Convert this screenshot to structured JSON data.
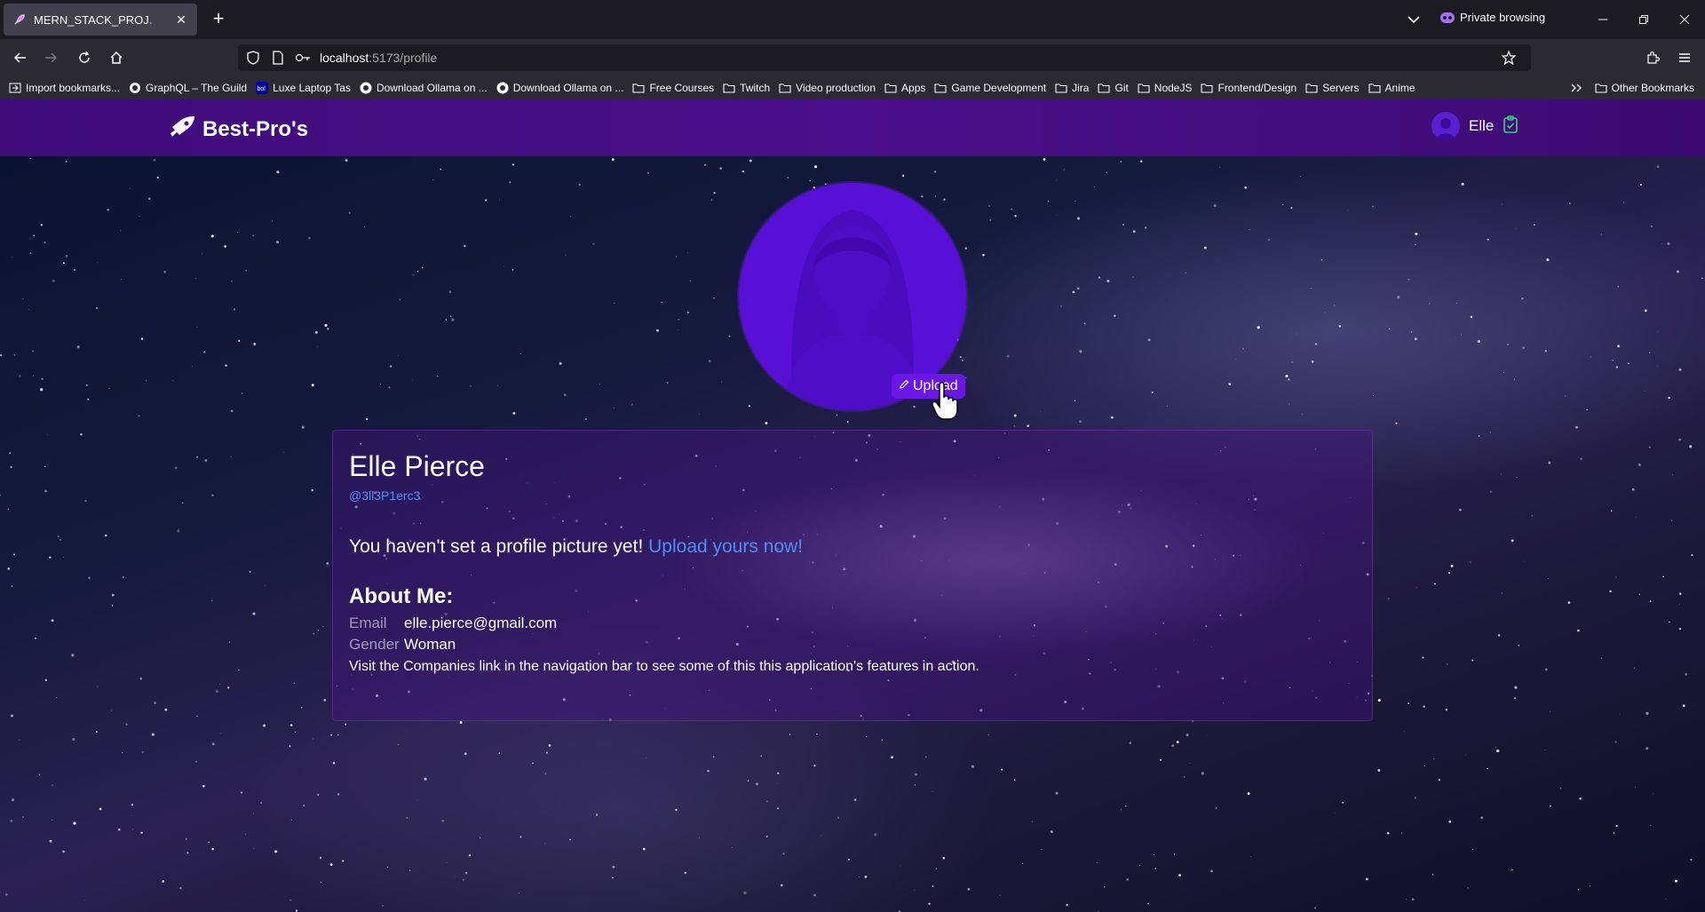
{
  "browser": {
    "tab_title": "MERN_STACK_PROJ.",
    "new_tab": "+",
    "private_label": "Private browsing",
    "url_host": "localhost",
    "url_rest": ":5173/profile"
  },
  "bookmarks": [
    {
      "label": "Import bookmarks...",
      "icon": "import-icon"
    },
    {
      "label": "GraphQL – The Guild",
      "icon": "guild-icon"
    },
    {
      "label": "Luxe Laptop Tas",
      "icon": "bol-icon"
    },
    {
      "label": "Download Ollama on ...",
      "icon": "ollama-icon"
    },
    {
      "label": "Download Ollama on ...",
      "icon": "ollama-icon"
    },
    {
      "label": "Free Courses",
      "icon": "folder-icon"
    },
    {
      "label": "Twitch",
      "icon": "folder-icon"
    },
    {
      "label": "Video production",
      "icon": "folder-icon"
    },
    {
      "label": "Apps",
      "icon": "folder-icon"
    },
    {
      "label": "Game Development",
      "icon": "folder-icon"
    },
    {
      "label": "Jira",
      "icon": "folder-icon"
    },
    {
      "label": "Git",
      "icon": "folder-icon"
    },
    {
      "label": "NodeJS",
      "icon": "folder-icon"
    },
    {
      "label": "Frontend/Design",
      "icon": "folder-icon"
    },
    {
      "label": "Servers",
      "icon": "folder-icon"
    },
    {
      "label": "Anime",
      "icon": "folder-icon"
    }
  ],
  "other_bookmarks": "Other Bookmarks",
  "app": {
    "logo": "Best-Pro's",
    "user_name": "Elle"
  },
  "profile": {
    "upload_label": "Upload",
    "name": "Elle Pierce",
    "handle": "@3ll3P1erc3",
    "notice_text": "You haven't set a profile picture yet!",
    "notice_link": "Upload yours now!",
    "about_title": "About Me:",
    "email_label": "Email",
    "email_value": "elle.pierce@gmail.com",
    "gender_label": "Gender",
    "gender_value": "Woman",
    "info_text": "Visit the Companies link in the navigation bar to see some of this this application's features in action."
  },
  "colors": {
    "appbar": "#4a0f8a",
    "avatar_bg": "#5810d6",
    "link": "#4f8ef7",
    "upload_button": "#6a16e6"
  }
}
